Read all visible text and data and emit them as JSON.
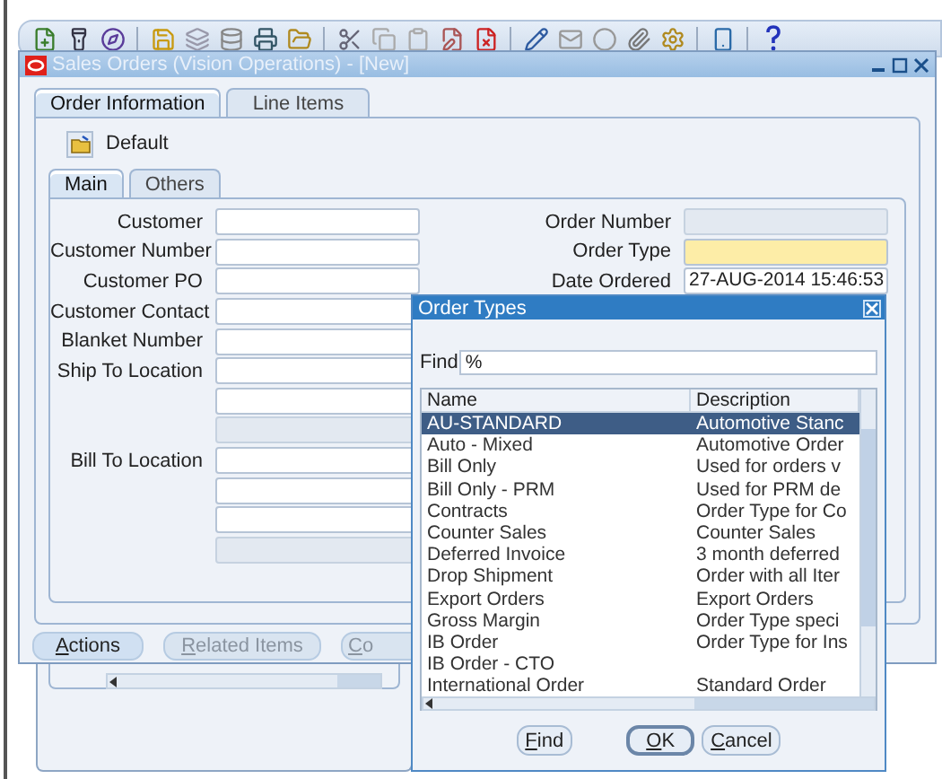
{
  "window": {
    "title": "Sales Orders (Vision Operations) - [New]",
    "tabs": [
      {
        "label": "Order Information",
        "selected": true
      },
      {
        "label": "Line Items",
        "selected": false
      }
    ],
    "folder": {
      "label": "Default"
    },
    "subtabs": [
      {
        "label": "Main",
        "selected": true
      },
      {
        "label": "Others",
        "selected": false
      }
    ],
    "left_fields": [
      {
        "label": "Customer",
        "kind": "text"
      },
      {
        "label": "Customer Number",
        "kind": "text"
      },
      {
        "label": "Customer PO",
        "kind": "text"
      },
      {
        "label": "Customer Contact",
        "kind": "text"
      },
      {
        "label": "Blanket Number",
        "kind": "text"
      },
      {
        "label": "Ship To Location",
        "kind": "text"
      },
      {
        "kind": "text"
      },
      {
        "kind": "readonly"
      },
      {
        "label": "Bill To Location",
        "kind": "text"
      },
      {
        "kind": "text"
      },
      {
        "kind": "text"
      },
      {
        "kind": "readonly"
      }
    ],
    "right_fields": [
      {
        "label": "Order Number",
        "kind": "readonly"
      },
      {
        "label": "Order Type",
        "kind": "required"
      },
      {
        "label": "Date Ordered",
        "kind": "text",
        "value": "27-AUG-2014 15:46:53"
      }
    ],
    "buttons": [
      {
        "label": "Actions",
        "disabled": false
      },
      {
        "label": "Related Items",
        "disabled": true
      },
      {
        "label": "Co",
        "disabled": true
      }
    ]
  },
  "dialog": {
    "title": "Order Types",
    "find": {
      "label": "Find",
      "value": "%"
    },
    "columns": [
      "Name",
      "Description"
    ],
    "rows": [
      {
        "name": "AU-STANDARD",
        "description": "Automotive Stanc",
        "selected": true
      },
      {
        "name": "Auto - Mixed",
        "description": "Automotive Order",
        "selected": false
      },
      {
        "name": "Bill Only",
        "description": "Used for orders v",
        "selected": false
      },
      {
        "name": "Bill Only - PRM",
        "description": "Used for PRM de",
        "selected": false
      },
      {
        "name": "Contracts",
        "description": "Order Type for Co",
        "selected": false
      },
      {
        "name": "Counter Sales",
        "description": "Counter Sales",
        "selected": false
      },
      {
        "name": "Deferred Invoice",
        "description": "3 month deferred",
        "selected": false
      },
      {
        "name": "Drop Shipment",
        "description": "Order with all Iter",
        "selected": false
      },
      {
        "name": "Export Orders",
        "description": "Export Orders",
        "selected": false
      },
      {
        "name": "Gross Margin",
        "description": "Order Type speci",
        "selected": false
      },
      {
        "name": "IB Order",
        "description": "Order Type for Ins",
        "selected": false
      },
      {
        "name": "IB Order - CTO",
        "selected": false
      },
      {
        "name": "International Order",
        "description": "Standard Order",
        "selected": false
      }
    ],
    "buttons": [
      {
        "label": "Find",
        "default": false
      },
      {
        "label": "OK",
        "default": true
      },
      {
        "label": "Cancel",
        "default": false
      }
    ]
  }
}
